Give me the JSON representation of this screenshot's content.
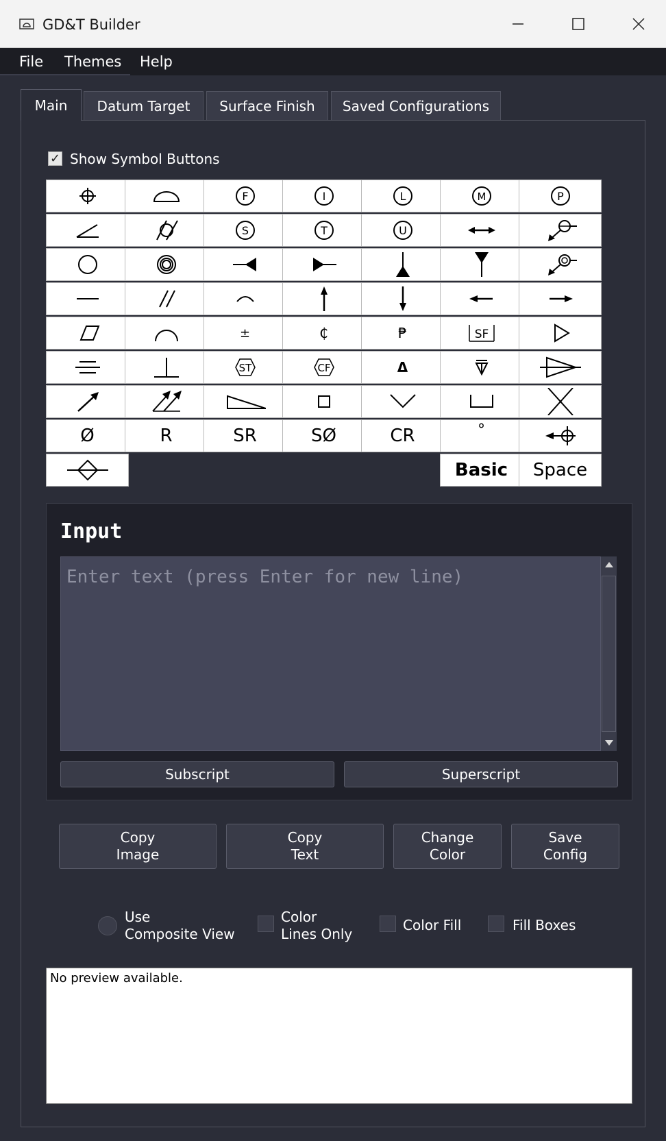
{
  "window": {
    "title": "GD&T Builder"
  },
  "menu": {
    "file": "File",
    "themes": "Themes",
    "help": "Help"
  },
  "tabs": [
    {
      "label": "Main",
      "active": true
    },
    {
      "label": "Datum Target"
    },
    {
      "label": "Surface Finish"
    },
    {
      "label": "Saved Configurations"
    }
  ],
  "show_symbols": {
    "label": "Show Symbol Buttons",
    "checked": true,
    "check_glyph": "✓"
  },
  "symbols": {
    "plus_minus": "±",
    "cent": "₵",
    "peso": "₱",
    "delta": "Δ",
    "dia": "Ø",
    "radius": "R",
    "sphere_radius": "SR",
    "sphere_dia": "SØ",
    "controlled_radius": "CR",
    "degree": "°",
    "basic": "Basic",
    "space": "Space",
    "sf": "SF",
    "st": "ST",
    "cf": "CF",
    "circle_f": "F",
    "circle_i": "I",
    "circle_l": "L",
    "circle_m": "M",
    "circle_p": "P",
    "circle_s": "S",
    "circle_t": "T",
    "circle_u": "U"
  },
  "input": {
    "title": "Input",
    "placeholder": "Enter text (press Enter for new line)",
    "value": "",
    "subscript": "Subscript",
    "superscript": "Superscript"
  },
  "actions": {
    "copy_image": "Copy\nImage",
    "copy_text": "Copy\nText",
    "change_color": "Change\nColor",
    "save_config": "Save\nConfig"
  },
  "options": {
    "composite_view": "Use\nComposite View",
    "color_lines_only": "Color\nLines Only",
    "color_fill": "Color Fill",
    "fill_boxes": "Fill Boxes"
  },
  "preview": {
    "text": "No preview available."
  },
  "colors": {
    "background": "#2b2d38",
    "menubar": "#1c1d23",
    "input_bg": "#444659"
  }
}
